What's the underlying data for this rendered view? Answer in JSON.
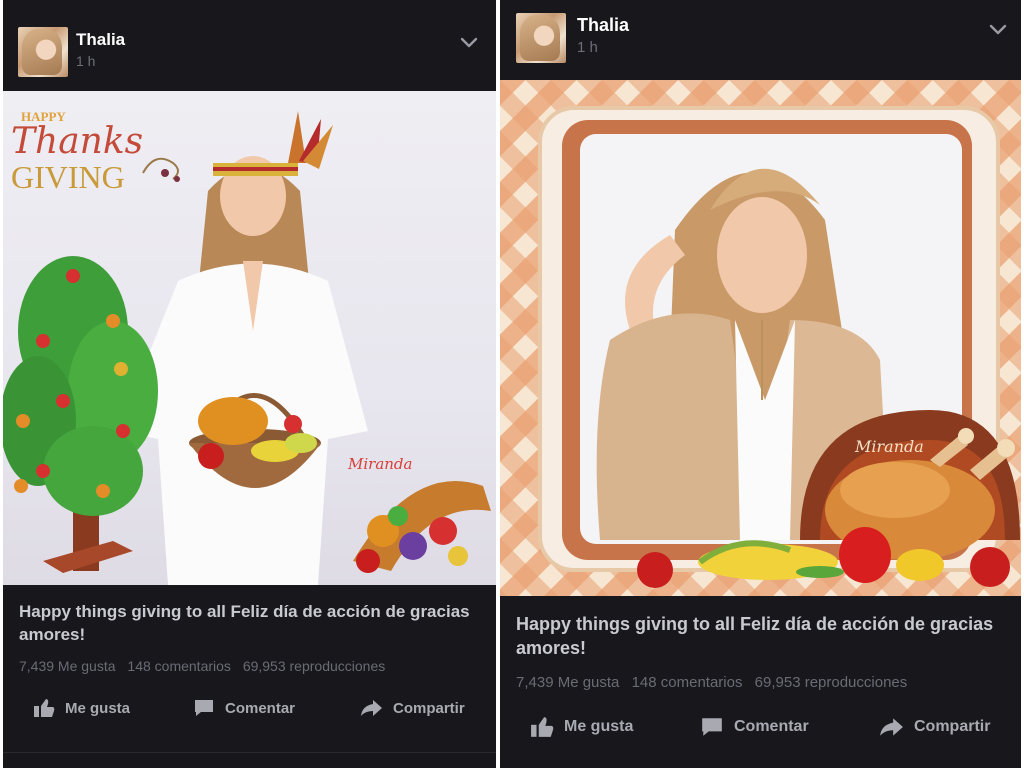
{
  "posts": [
    {
      "author": "Thalia",
      "time": "1 h",
      "image": {
        "title_happy": "HAPPY",
        "title_thanks": "Thanks",
        "title_giving": "GIVING",
        "signature": "Miranda"
      },
      "caption": "Happy things giving to all Feliz día de acción de gracias amores!",
      "stats": {
        "likes": "7,439 Me gusta",
        "comments": "148 comentarios",
        "views": "69,953 reproducciones"
      },
      "actions": {
        "like": "Me gusta",
        "comment": "Comentar",
        "share": "Compartir"
      }
    },
    {
      "author": "Thalia",
      "time": "1 h",
      "image": {
        "signature": "Miranda"
      },
      "caption": "Happy things giving to all Feliz día de acción de gracias amores!",
      "stats": {
        "likes": "7,439 Me gusta",
        "comments": "148 comentarios",
        "views": "69,953 reproducciones"
      },
      "actions": {
        "like": "Me gusta",
        "comment": "Comentar",
        "share": "Compartir"
      }
    }
  ],
  "colors": {
    "background": "#17171c",
    "text_primary": "#ffffff",
    "text_secondary": "#6b6b75",
    "caption": "#c9c9d0"
  },
  "icons": [
    "chevron-down-icon",
    "like-thumb-icon",
    "comment-bubble-icon",
    "share-arrow-icon"
  ]
}
